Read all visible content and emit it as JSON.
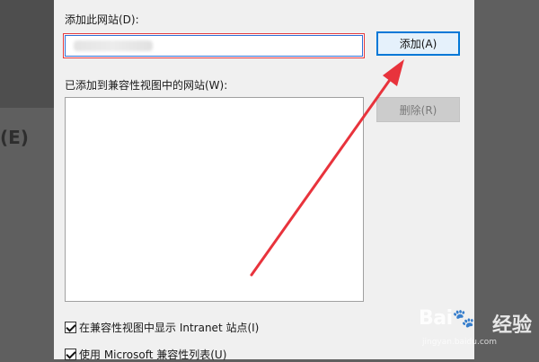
{
  "background": {
    "partial_label": "(E)"
  },
  "dialog": {
    "add_site_label": "添加此网站(D):",
    "add_site_input_value": "",
    "add_button_label": "添加(A)",
    "sites_list_label": "已添加到兼容性视图中的网站(W):",
    "sites_list_items": [],
    "remove_button_label": "删除(R)",
    "options": [
      {
        "label": "在兼容性视图中显示 Intranet 站点(I)",
        "checked": true
      },
      {
        "label": "使用 Microsoft 兼容性列表(U)",
        "checked": true
      }
    ]
  },
  "annotation": {
    "arrow_color": "#e8333c"
  },
  "watermark": {
    "logo_text": "Bai",
    "logo_suffix": "百",
    "jingyan": "经验",
    "url": "jingyan.baidu.com"
  }
}
